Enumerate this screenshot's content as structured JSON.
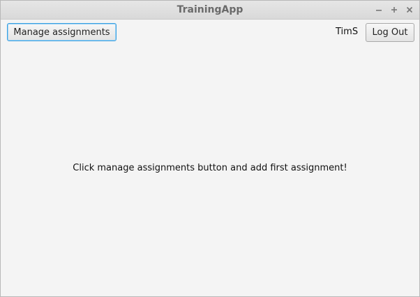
{
  "window": {
    "title": "TrainingApp",
    "controls": {
      "minimize_icon": "minimize-icon",
      "maximize_icon": "maximize-icon",
      "close_icon": "close-icon"
    }
  },
  "toolbar": {
    "manage_label": "Manage assignments",
    "username": "TimS",
    "logout_label": "Log Out"
  },
  "main": {
    "empty_message": "Click manage assignments button and add first assignment!"
  },
  "colors": {
    "focus_border": "#3aa0e0",
    "background": "#f4f4f4",
    "title_text": "#6a6a6a"
  }
}
